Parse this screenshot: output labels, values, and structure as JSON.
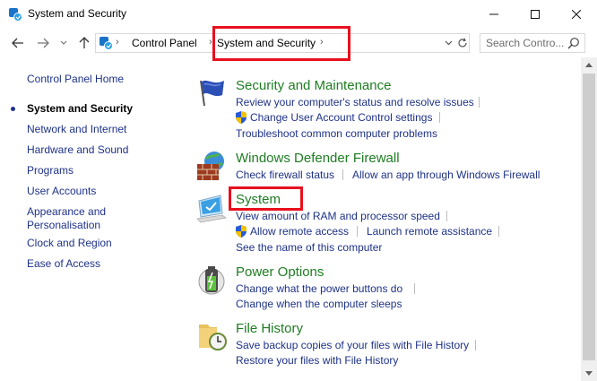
{
  "window": {
    "title": "System and Security"
  },
  "nav": {
    "breadcrumbs": [
      "Control Panel",
      "System and Security"
    ],
    "search_placeholder": "Search Contro..."
  },
  "left_pane": {
    "items": [
      {
        "label": "Control Panel Home"
      },
      {
        "label": "System and Security"
      },
      {
        "label": "Network and Internet"
      },
      {
        "label": "Hardware and Sound"
      },
      {
        "label": "Programs"
      },
      {
        "label": "User Accounts"
      },
      {
        "label": "Appearance and Personalisation"
      },
      {
        "label": "Clock and Region"
      },
      {
        "label": "Ease of Access"
      }
    ]
  },
  "categories": [
    {
      "title": "Security and Maintenance",
      "icon": "flag-icon",
      "tasks": [
        "Review your computer's status and resolve issues",
        "Change User Account Control settings",
        "Troubleshoot common computer problems"
      ]
    },
    {
      "title": "Windows Defender Firewall",
      "icon": "firewall-icon",
      "tasks": [
        "Check firewall status",
        "Allow an app through Windows Firewall"
      ]
    },
    {
      "title": "System",
      "icon": "computer-icon",
      "tasks": [
        "View amount of RAM and processor speed",
        "Allow remote access",
        "Launch remote assistance",
        "See the name of this computer"
      ]
    },
    {
      "title": "Power Options",
      "icon": "battery-icon",
      "tasks": [
        "Change what the power buttons do",
        "Change when the computer sleeps"
      ]
    },
    {
      "title": "File History",
      "icon": "folder-clock-icon",
      "tasks": [
        "Save backup copies of your files with File History",
        "Restore your files with File History"
      ]
    }
  ],
  "colors": {
    "link": "#1e3287",
    "category": "#1e7d22",
    "highlight": "#e8101e"
  }
}
